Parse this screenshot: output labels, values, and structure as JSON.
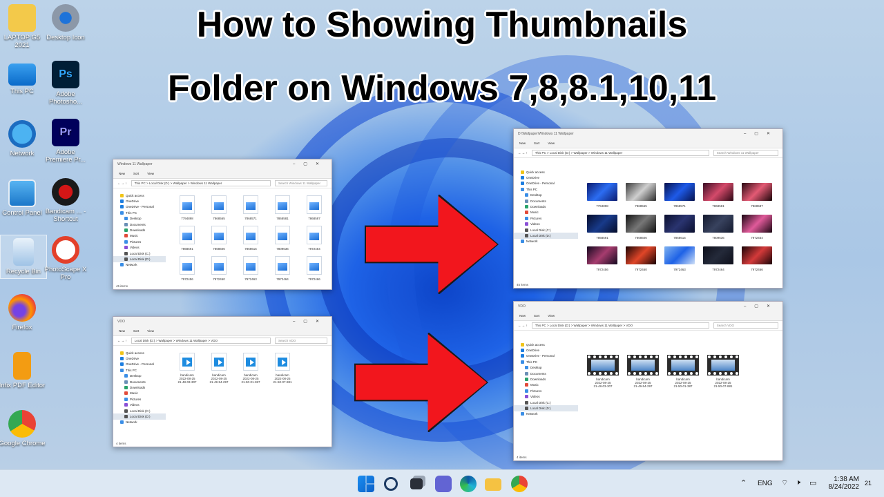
{
  "title": {
    "line1": "How to Showing Thumbnails",
    "line2": "Folder on Windows 7,8,8.1,10,11"
  },
  "desktop_icons": [
    {
      "label": "LAPTOP G5 2021",
      "icon": "folder-icon"
    },
    {
      "label": "Desktop Icon",
      "icon": "gear-icon"
    },
    {
      "label": "This PC",
      "icon": "monitor-icon"
    },
    {
      "label": "Adobe Photosho...",
      "icon": "photoshop-icon"
    },
    {
      "label": "Network",
      "icon": "network-icon"
    },
    {
      "label": "Adobe Premiere Pr...",
      "icon": "premiere-icon"
    },
    {
      "label": "Control Panel",
      "icon": "control-panel-icon"
    },
    {
      "label": "Bandicam ... - Shortcut",
      "icon": "bandicam-icon"
    },
    {
      "label": "Recycle Bin",
      "icon": "recycle-bin-icon"
    },
    {
      "label": "PhotoScape X Pro",
      "icon": "photoscape-icon"
    },
    {
      "label": "Firefox",
      "icon": "firefox-icon"
    },
    {
      "label": "Infix PDF Editor",
      "icon": "pdf-editor-icon"
    },
    {
      "label": "Google Chrome",
      "icon": "chrome-icon"
    }
  ],
  "explorer": {
    "new": "New",
    "sort": "Sort",
    "view": "View",
    "nav": [
      "Quick access",
      "OneDrive",
      "OneDrive - Personal",
      "This PC",
      "Desktop",
      "Documents",
      "Downloads",
      "Music",
      "Pictures",
      "Videos",
      "Local Disk (C:)",
      "Local Disk (D:)",
      "Network"
    ],
    "wallpaper": {
      "window_title": "Windows 11 Wallpaper",
      "window_title_full": "D:\\Wallpaper\\Windows 11 Wallpaper",
      "path": "This PC  >  Local Disk (D:)  >  Wallpaper  >  Windows 11 Wallpaper",
      "search": "Search Windows 11 Wallpaper",
      "files": [
        "7794898",
        "7868565",
        "7868571",
        "7868581",
        "7868587",
        "7868591",
        "7868606",
        "7868615",
        "7809636",
        "7972454",
        "7972456",
        "7972460",
        "7972463",
        "7972464",
        "7972466"
      ],
      "status": "45 items"
    },
    "vdo": {
      "window_title": "VDO",
      "path": "Local Disk (D:)  >  Wallpaper  >  Windows 11 Wallpaper  >  VDO",
      "path_after": "This PC  >  Local Disk (D:)  >  Wallpaper  >  Windows 11 Wallpaper  >  VDO",
      "search": "Search VDO",
      "files": [
        {
          "name": "bandicam",
          "date": "2022-08-25",
          "time": "21-48-03-307"
        },
        {
          "name": "bandicam",
          "date": "2022-08-25",
          "time": "21-49-54-297"
        },
        {
          "name": "bandicam",
          "date": "2022-08-25",
          "time": "21-50-01-387"
        },
        {
          "name": "bandicam",
          "date": "2022-08-25",
          "time": "21-50-07-881"
        }
      ],
      "status": "4 items"
    }
  },
  "taskbar": {
    "icons": [
      "windows-start-icon",
      "search-icon",
      "task-view-icon",
      "teams-icon",
      "edge-icon",
      "file-explorer-icon",
      "chrome-icon"
    ],
    "lang": "ENG",
    "time": "1:38 AM",
    "date": "8/24/2022",
    "notifications": "21"
  },
  "colors": {
    "arrow": "#f2161d",
    "taskbar": "#dde8f3"
  }
}
